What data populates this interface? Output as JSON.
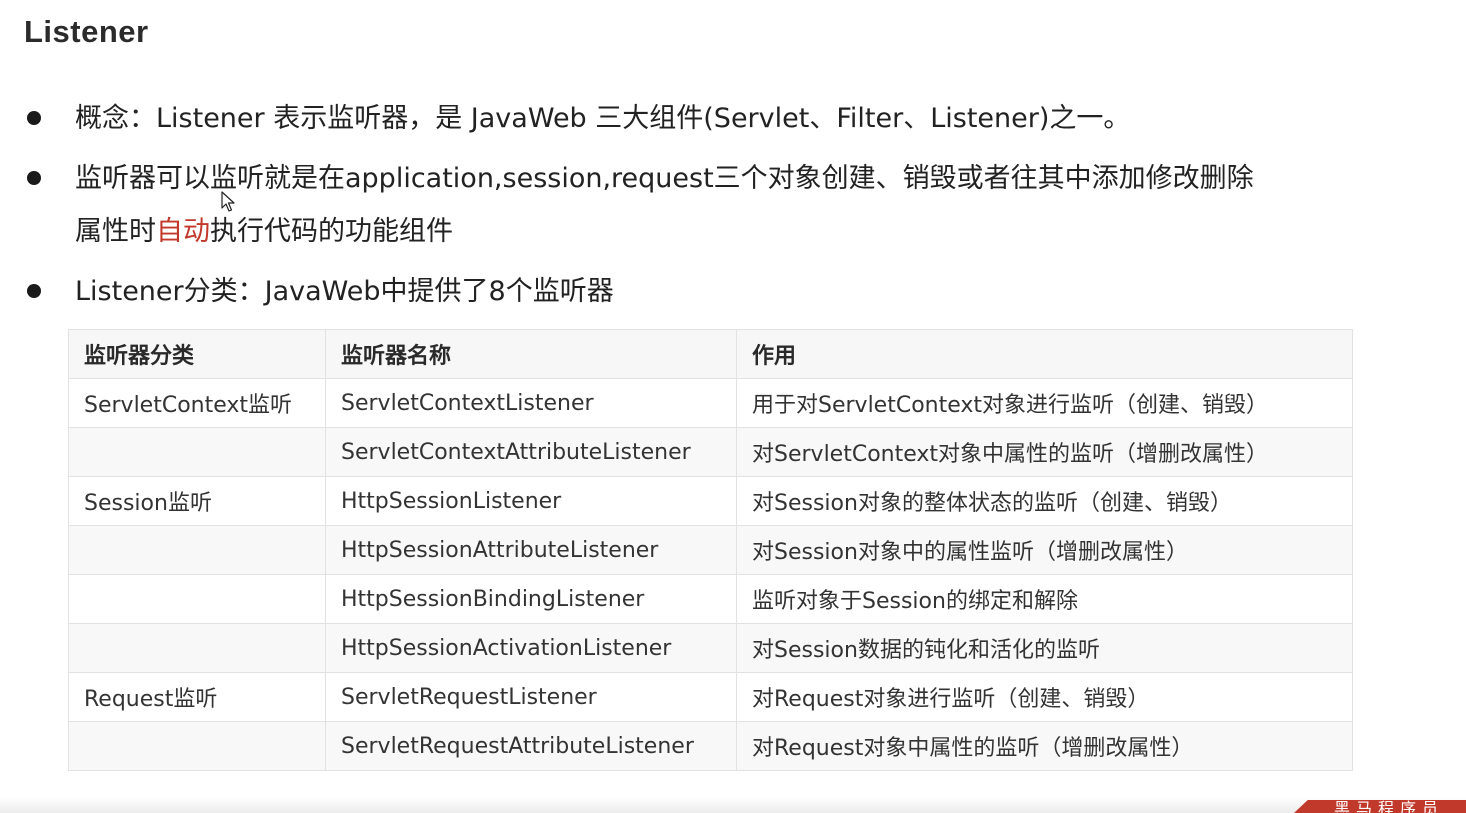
{
  "page": {
    "title": "Listener"
  },
  "bullets": [
    {
      "text": "概念：Listener 表示监听器，是 JavaWeb 三大组件(Servlet、Filter、Listener)之一。"
    },
    {
      "line1": "监听器可以监听就是在application,session,request三个对象创建、销毁或者往其中添加修改删除",
      "line2_before": "属性时",
      "line2_highlight": "自动",
      "line2_after": "执行代码的功能组件"
    },
    {
      "text": "Listener分类：JavaWeb中提供了8个监听器"
    }
  ],
  "table": {
    "headers": [
      "监听器分类",
      "监听器名称",
      "作用"
    ],
    "rows": [
      {
        "category": "ServletContext监听",
        "name": "ServletContextListener",
        "purpose": "用于对ServletContext对象进行监听（创建、销毁）"
      },
      {
        "category": "",
        "name": "ServletContextAttributeListener",
        "purpose": "对ServletContext对象中属性的监听（增删改属性）"
      },
      {
        "category": "Session监听",
        "name": "HttpSessionListener",
        "purpose": "对Session对象的整体状态的监听（创建、销毁）"
      },
      {
        "category": "",
        "name": "HttpSessionAttributeListener",
        "purpose": "对Session对象中的属性监听（增删改属性）"
      },
      {
        "category": "",
        "name": "HttpSessionBindingListener",
        "purpose": "监听对象于Session的绑定和解除"
      },
      {
        "category": "",
        "name": "HttpSessionActivationListener",
        "purpose": "对Session数据的钝化和活化的监听"
      },
      {
        "category": "Request监听",
        "name": "ServletRequestListener",
        "purpose": "对Request对象进行监听（创建、销毁）"
      },
      {
        "category": "",
        "name": "ServletRequestAttributeListener",
        "purpose": "对Request对象中属性的监听（增删改属性）"
      }
    ]
  },
  "colors": {
    "highlight": "#c0392b",
    "banner": "#c0392b"
  },
  "icons": {
    "cursor": "mouse-pointer-icon",
    "bullet": "bullet-dot-icon"
  },
  "banner": {
    "text": "黑马程序员"
  }
}
